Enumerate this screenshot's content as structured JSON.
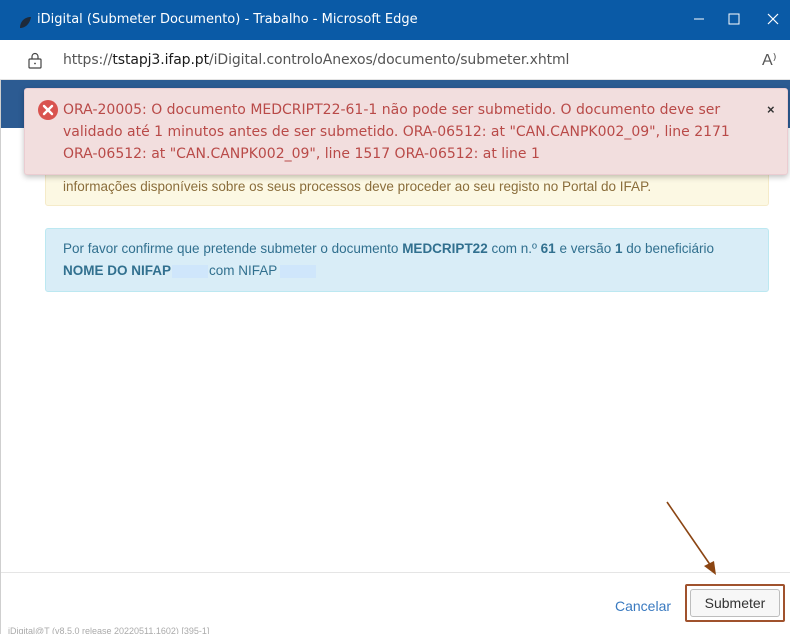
{
  "window": {
    "title": "iDigital (Submeter Documento) - Trabalho - Microsoft Edge",
    "min_icon": "minimize-icon",
    "max_icon": "maximize-icon",
    "close_icon": "close-icon"
  },
  "address": {
    "scheme": "https://",
    "host": "tstapj3.ifap.pt",
    "path": "/iDigital.controloAnexos/documento/submeter.xhtml",
    "read_aloud": "A⁾"
  },
  "error": {
    "message": "ORA-20005: O documento MEDCRIPT22-61-1 não pode ser submetido. O documento deve ser validado até 1 minutos antes de ser submetido. ORA-06512: at \"CAN.CANPK002_09\", line 2171 ORA-06512: at \"CAN.CANPK002_09\", line 1517 ORA-06512: at line 1",
    "dismiss": "×"
  },
  "warning": {
    "text": "informações disponíveis sobre os seus processos deve proceder ao seu registo no Portal do IFAP."
  },
  "confirm": {
    "p1": "Por favor confirme que pretende submeter o documento ",
    "doc": "MEDCRIPT22",
    "p2": " com n.º ",
    "num": "61",
    "p3": " e versão ",
    "ver": "1",
    "p4": " do beneficiário ",
    "benef": "NOME DO NIFAP",
    "p5": "com NIFAP"
  },
  "footer": {
    "cancel_label": "Cancelar",
    "submit_label": "Submeter",
    "version": "iDigital@T (v8.5.0 release 20220511.1602) [395-1]"
  },
  "colors": {
    "titlebar": "#0a5aa6",
    "error_text": "#b94a48",
    "annotation_arrow": "#8b4513"
  }
}
